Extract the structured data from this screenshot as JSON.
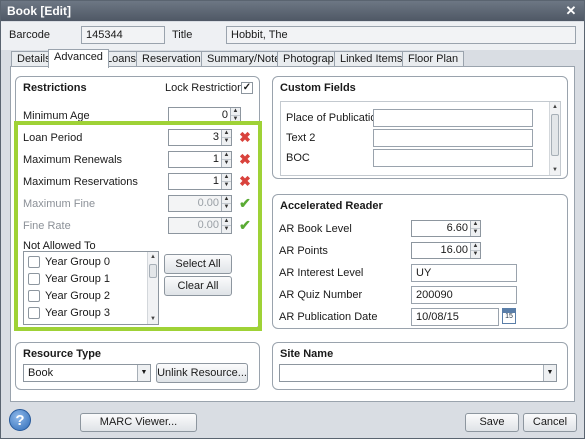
{
  "window": {
    "title": "Book [Edit]",
    "close": "✕"
  },
  "header": {
    "barcode_label": "Barcode",
    "barcode_value": "145344",
    "title_label": "Title",
    "title_value": "Hobbit, The"
  },
  "tabs": [
    "Details",
    "Advanced",
    "Loans",
    "Reservations",
    "Summary/Notes",
    "Photograph",
    "Linked Items",
    "Floor Plan"
  ],
  "active_tab": "Advanced",
  "restrictions": {
    "heading": "Restrictions",
    "lock_label": "Lock Restrictions",
    "lock_checked": "✓",
    "rows": [
      {
        "label": "Minimum Age",
        "value": "0"
      },
      {
        "label": "Loan Period",
        "value": "3"
      },
      {
        "label": "Maximum Renewals",
        "value": "1"
      },
      {
        "label": "Maximum Reservations",
        "value": "1"
      },
      {
        "label": "Maximum Fine",
        "value": "0.00"
      },
      {
        "label": "Fine Rate",
        "value": "0.00"
      }
    ],
    "not_allowed_label": "Not Allowed To",
    "year_groups": [
      "Year Group 0",
      "Year Group 1",
      "Year Group 2",
      "Year Group 3"
    ],
    "select_all": "Select All",
    "clear_all": "Clear All"
  },
  "custom_fields": {
    "heading": "Custom Fields",
    "fields": [
      {
        "label": "Place of Publication",
        "value": ""
      },
      {
        "label": "Text 2",
        "value": ""
      },
      {
        "label": "BOC",
        "value": ""
      }
    ]
  },
  "accelerated_reader": {
    "heading": "Accelerated Reader",
    "book_level_label": "AR Book Level",
    "book_level": "6.60",
    "points_label": "AR Points",
    "points": "16.00",
    "interest_label": "AR Interest Level",
    "interest": "UY",
    "quiz_label": "AR Quiz Number",
    "quiz": "200090",
    "pubdate_label": "AR Publication Date",
    "pubdate": "10/08/15",
    "calendar_day": "15"
  },
  "resource_type": {
    "heading": "Resource Type",
    "value": "Book",
    "unlink": "Unlink Resource..."
  },
  "site_name": {
    "heading": "Site Name",
    "value": ""
  },
  "footer": {
    "help": "?",
    "marc": "MARC Viewer...",
    "save": "Save",
    "cancel": "Cancel"
  },
  "colors": {
    "highlight": "#9fd236",
    "delete": "#d9423c",
    "ok": "#5aab34"
  }
}
